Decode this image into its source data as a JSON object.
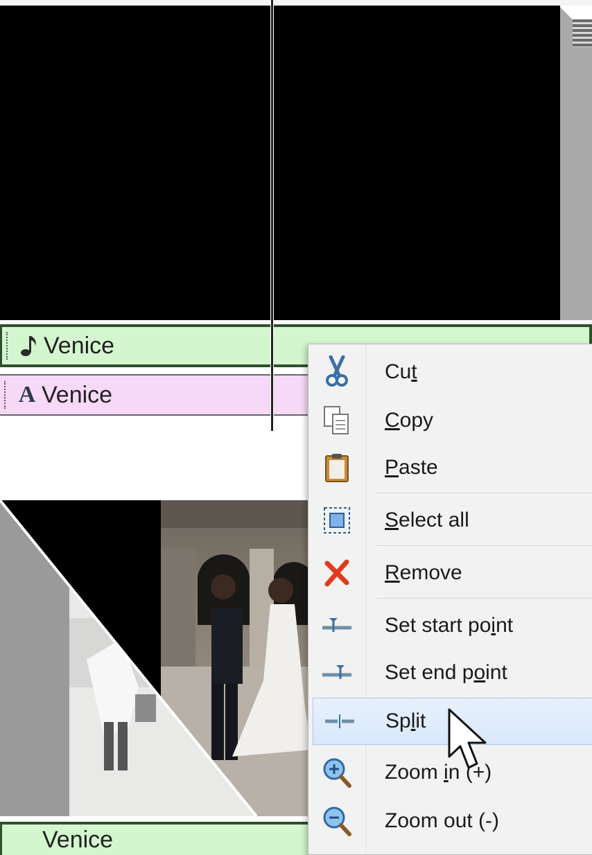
{
  "timeline": {
    "music_track": {
      "label": "Venice",
      "icon": "music-note-icon"
    },
    "caption_track": {
      "label": "Venice",
      "icon": "caption-text-icon"
    },
    "bottom_track": {
      "label": "Venice"
    }
  },
  "context_menu": {
    "items": [
      {
        "id": "cut",
        "pre": "Cu",
        "accel": "t",
        "post": "",
        "icon": "scissors-icon"
      },
      {
        "id": "copy",
        "pre": "",
        "accel": "C",
        "post": "opy",
        "icon": "copy-icon"
      },
      {
        "id": "paste",
        "pre": "",
        "accel": "P",
        "post": "aste",
        "icon": "clipboard-icon"
      },
      {
        "id": "select-all",
        "pre": "",
        "accel": "S",
        "post": "elect all",
        "icon": "select-all-icon"
      },
      {
        "id": "remove",
        "pre": "",
        "accel": "R",
        "post": "emove",
        "icon": "red-x-icon"
      },
      {
        "id": "set-start-point",
        "pre": "Set start po",
        "accel": "i",
        "post": "nt",
        "icon": "set-start-point-icon"
      },
      {
        "id": "set-end-point",
        "pre": "Set end p",
        "accel": "o",
        "post": "int",
        "icon": "set-end-point-icon"
      },
      {
        "id": "split",
        "pre": "Sp",
        "accel": "l",
        "post": "it",
        "icon": "split-icon"
      },
      {
        "id": "zoom-in",
        "pre": "Zoom ",
        "accel": "i",
        "post": "n (+)",
        "icon": "zoom-in-icon"
      },
      {
        "id": "zoom-out",
        "pre": "Zoom out (-)",
        "accel": "",
        "post": "",
        "icon": "zoom-out-icon"
      }
    ]
  },
  "colors": {
    "music_track": "#d4f6cf",
    "caption_track": "#f6d9f6",
    "menu_background": "#f2f2f2",
    "hover_highlight": "#d8e8fb"
  }
}
